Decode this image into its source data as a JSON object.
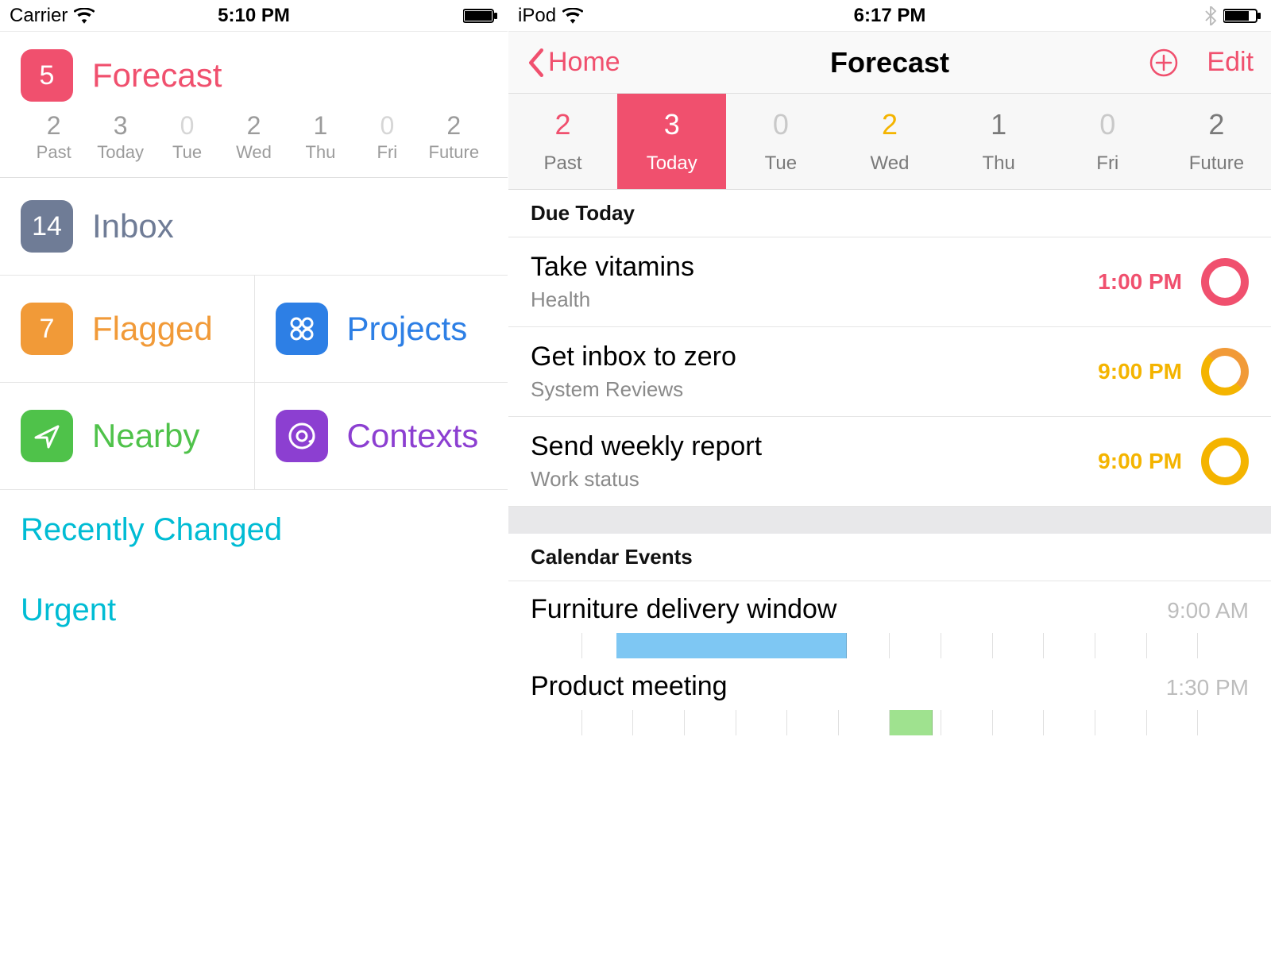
{
  "colors": {
    "pink": "#f0506e",
    "slate": "#6f7c96",
    "orange": "#f19a38",
    "blue": "#2d7fe5",
    "green": "#4fc24a",
    "purple": "#8c3fd1",
    "teal": "#00bcd4",
    "amber": "#f4b400",
    "grey_num": "#9b9b9b",
    "grey_dim": "#c9c9c9",
    "grey_time": "#bdbdbd"
  },
  "left": {
    "status": {
      "carrier": "Carrier",
      "time": "5:10 PM"
    },
    "forecast": {
      "count": "5",
      "label": "Forecast"
    },
    "days": [
      {
        "num": "2",
        "label": "Past"
      },
      {
        "num": "3",
        "label": "Today"
      },
      {
        "num": "0",
        "label": "Tue"
      },
      {
        "num": "2",
        "label": "Wed"
      },
      {
        "num": "1",
        "label": "Thu"
      },
      {
        "num": "0",
        "label": "Fri"
      },
      {
        "num": "2",
        "label": "Future"
      }
    ],
    "inbox": {
      "count": "14",
      "label": "Inbox"
    },
    "flagged": {
      "count": "7",
      "label": "Flagged"
    },
    "projects": {
      "label": "Projects"
    },
    "nearby": {
      "label": "Nearby"
    },
    "contexts": {
      "label": "Contexts"
    },
    "links": {
      "recent": "Recently Changed",
      "urgent": "Urgent"
    }
  },
  "right": {
    "status": {
      "device": "iPod",
      "time": "6:17 PM"
    },
    "nav": {
      "back": "Home",
      "title": "Forecast",
      "edit": "Edit"
    },
    "days": [
      {
        "num": "2",
        "label": "Past",
        "num_color": "#f0506e",
        "lbl_color": "#7a7a7a",
        "selected": false
      },
      {
        "num": "3",
        "label": "Today",
        "num_color": "#ffffff",
        "lbl_color": "#ffffff",
        "selected": true
      },
      {
        "num": "0",
        "label": "Tue",
        "num_color": "#c9c9c9",
        "lbl_color": "#7a7a7a",
        "selected": false
      },
      {
        "num": "2",
        "label": "Wed",
        "num_color": "#f4b400",
        "lbl_color": "#7a7a7a",
        "selected": false
      },
      {
        "num": "1",
        "label": "Thu",
        "num_color": "#7a7a7a",
        "lbl_color": "#7a7a7a",
        "selected": false
      },
      {
        "num": "0",
        "label": "Fri",
        "num_color": "#c9c9c9",
        "lbl_color": "#7a7a7a",
        "selected": false
      },
      {
        "num": "2",
        "label": "Future",
        "num_color": "#7a7a7a",
        "lbl_color": "#7a7a7a",
        "selected": false
      }
    ],
    "sections": {
      "due": "Due Today",
      "cal": "Calendar Events"
    },
    "tasks": [
      {
        "title": "Take vitamins",
        "sub": "Health",
        "time": "1:00 PM",
        "time_color": "#f0506e",
        "ring": "#f0506e",
        "ring2": ""
      },
      {
        "title": "Get inbox to zero",
        "sub": "System Reviews",
        "time": "9:00 PM",
        "time_color": "#f4b400",
        "ring": "#f19a38",
        "ring2": "#f4b400"
      },
      {
        "title": "Send weekly report",
        "sub": "Work status",
        "time": "9:00 PM",
        "time_color": "#f4b400",
        "ring": "#f4b400",
        "ring2": ""
      }
    ],
    "events": [
      {
        "title": "Furniture delivery window",
        "time": "9:00 AM",
        "bar_left_pct": 12,
        "bar_width_pct": 32,
        "bar_color": "blue"
      },
      {
        "title": "Product meeting",
        "time": "1:30 PM",
        "bar_left_pct": 50,
        "bar_width_pct": 6,
        "bar_color": "green"
      }
    ]
  }
}
